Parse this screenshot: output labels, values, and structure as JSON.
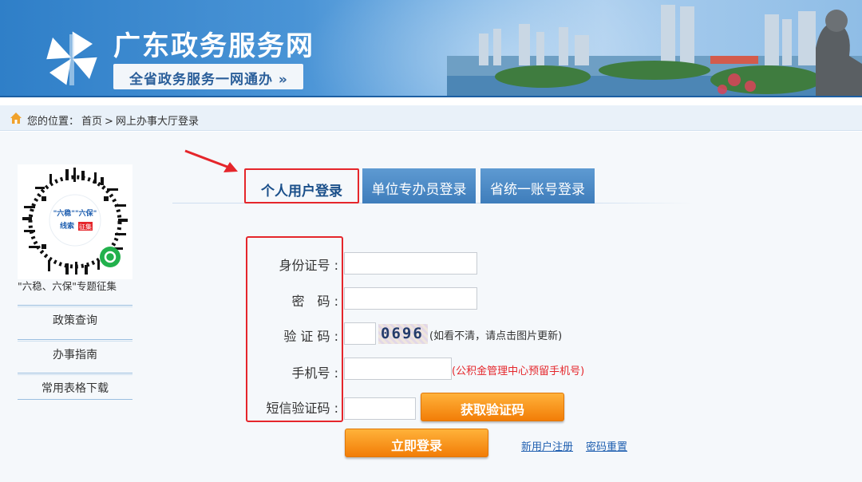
{
  "header": {
    "site_title": "广东政务服务网",
    "slogan": "全省政务服务一网通办 »"
  },
  "breadcrumb": {
    "prefix": "您的位置：",
    "items": [
      "首页",
      ">",
      "网上办事大厅登录"
    ]
  },
  "sidebar": {
    "qr_text_top": "\"六稳\"\"六保\"",
    "qr_text_bottom": "线索",
    "qr_badge": "征集",
    "qr_caption": "\"六稳、六保\"专题征集",
    "links": [
      "政策查询",
      "办事指南",
      "常用表格下载"
    ]
  },
  "tabs": [
    {
      "label": "个人用户登录",
      "active": true
    },
    {
      "label": "单位专办员登录",
      "active": false
    },
    {
      "label": "省统一账号登录",
      "active": false
    }
  ],
  "form": {
    "id_label": "身份证号 :",
    "password_label": "密　码 :",
    "captcha_label": "验 证 码 :",
    "captcha_value": "0696",
    "captcha_hint": "(如看不清，请点击图片更新)",
    "phone_label": "手机号 :",
    "phone_hint": "(公积金管理中心预留手机号)",
    "sms_label": "短信验证码 :",
    "get_code_button": "获取验证码",
    "login_button": "立即登录",
    "register_link": "新用户注册",
    "reset_link": "密码重置"
  },
  "colors": {
    "brand_blue": "#1c5fa3",
    "highlight_red": "#e5262b",
    "button_orange": "#f27d07",
    "hint_red": "#e5262b"
  }
}
